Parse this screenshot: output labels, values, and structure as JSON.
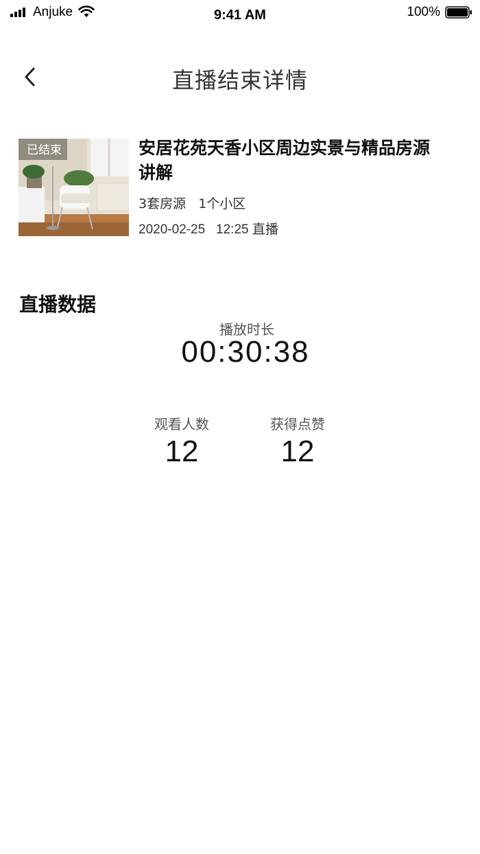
{
  "status_bar": {
    "carrier": "Anjuke",
    "time": "9:41 AM",
    "battery_percent": "100%"
  },
  "nav": {
    "back_icon": "chevron-left-icon",
    "title": "直播结束详情"
  },
  "live_card": {
    "badge": "已结束",
    "title": "安居花苑天香小区周边实景与精品房源讲解",
    "meta": "3套房源   1个小区",
    "time": "2020-02-25   12:25 直播"
  },
  "stats": {
    "section_title": "直播数据",
    "duration_label": "播放时长",
    "duration_value": "00:30:38",
    "viewers_label": "观看人数",
    "viewers_value": "12",
    "likes_label": "获得点赞",
    "likes_value": "12"
  }
}
